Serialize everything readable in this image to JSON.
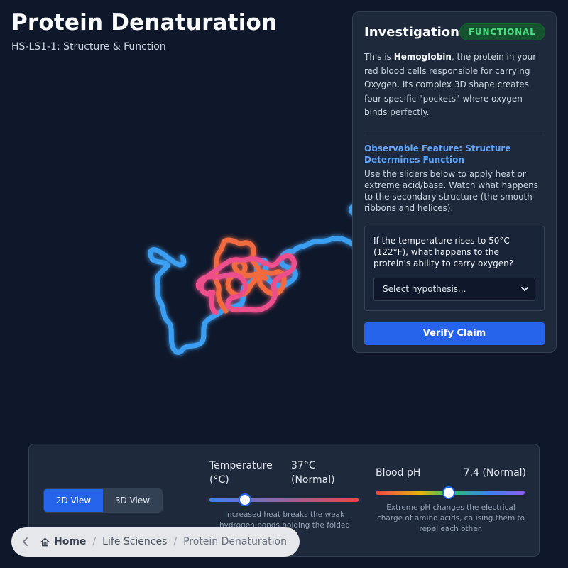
{
  "header": {
    "title": "Protein Denaturation",
    "subtitle": "HS-LS1-1: Structure & Function"
  },
  "panel": {
    "title": "Investigation",
    "status_badge": "FUNCTIONAL",
    "intro_prefix": "This is ",
    "intro_bold": "Hemoglobin",
    "intro_suffix": ", the protein in your red blood cells responsible for carrying Oxygen. Its complex 3D shape creates four specific \"pockets\" where oxygen binds perfectly.",
    "feature_title": "Observable Feature: Structure Determines Function",
    "feature_text": "Use the sliders below to apply heat or extreme acid/base. Watch what happens to the secondary structure (the smooth ribbons and helices).",
    "question": "If the temperature rises to 50°C (122°F), what happens to the protein's ability to carry oxygen?",
    "select_placeholder": "Select hypothesis...",
    "verify_label": "Verify Claim"
  },
  "controls": {
    "view_2d": "2D View",
    "view_3d": "3D View",
    "temperature": {
      "label": "Temperature (°C)",
      "value": "37°C (Normal)",
      "level": 0.24,
      "description": "Increased heat breaks the weak hydrogen bonds holding the folded shape"
    },
    "ph": {
      "label": "Blood pH",
      "value": "7.4 (Normal)",
      "level": 0.49,
      "description": "Extreme pH changes the electrical charge of amino acids, causing them to repel each other."
    }
  },
  "breadcrumb": {
    "home": "Home",
    "section": "Life Sciences",
    "current": "Protein Denaturation"
  },
  "icons": {
    "back": "chevron-left-icon",
    "home": "home-icon",
    "select": "chevron-down-icon"
  },
  "colors": {
    "accent": "#2563eb",
    "badge": "#4ade80",
    "chain_blue": "#3b9ef0",
    "chain_orange": "#f26a3f",
    "chain_pink": "#ec4f8c"
  }
}
